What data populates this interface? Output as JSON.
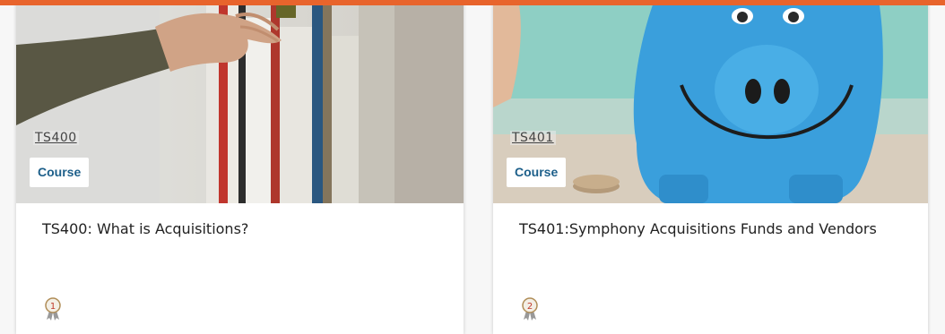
{
  "colors": {
    "accent_bar": "#e8642c",
    "badge_text": "#1d5f8a",
    "award_number": "#c0392b"
  },
  "cards": [
    {
      "code": "TS400",
      "type_label": "Course",
      "title": "TS400: What is Acquisitions?",
      "award_level": "1",
      "image": "hand-reaching-bookshelf"
    },
    {
      "code": "TS401",
      "type_label": "Course",
      "title": "TS401:Symphony Acquisitions Funds and Vendors",
      "award_level": "2",
      "image": "blue-piggy-bank"
    }
  ]
}
